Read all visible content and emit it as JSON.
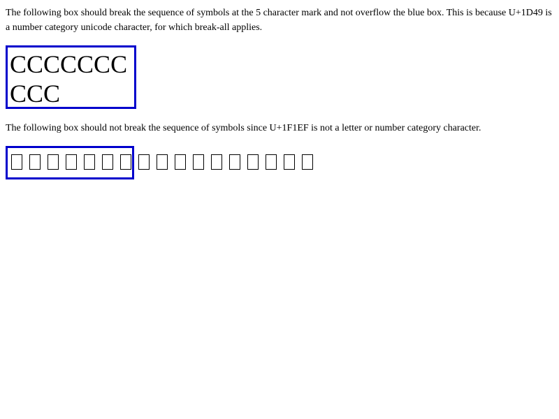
{
  "paragraph1": "The following box should break the sequence of symbols at the 5 character mark and not overflow the blue box. This is because U+1D49 is a number category unicode character, for which break-all applies.",
  "box1": {
    "line1": "CCCCCCC",
    "line2": "CCC"
  },
  "paragraph2": "The following box should not break the sequence of symbols since U+1F1EF is not a letter or number category character.",
  "box2": {
    "glyph": "tofu-box-icon"
  },
  "colors": {
    "box_border": "#0000cc"
  }
}
